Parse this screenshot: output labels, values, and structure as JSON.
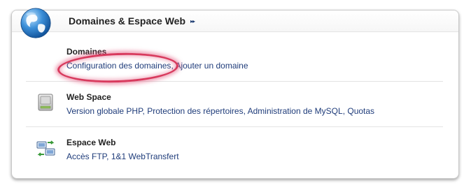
{
  "panel": {
    "title": "Domaines & Espace Web",
    "arrow": "▸▸"
  },
  "sections": [
    {
      "title": "Domaines",
      "links": [
        "Configuration des domaines",
        "Ajouter un domaine"
      ]
    },
    {
      "title": "Web Space",
      "links": [
        "Version globale PHP",
        "Protection des répertoires",
        "Administration de MySQL",
        "Quotas"
      ]
    },
    {
      "title": "Espace Web",
      "links": [
        "Accès FTP",
        "1&1 WebTransfert"
      ]
    }
  ],
  "separator": ", ",
  "colors": {
    "link": "#1f3c7a",
    "highlight": "#d83a5d"
  }
}
